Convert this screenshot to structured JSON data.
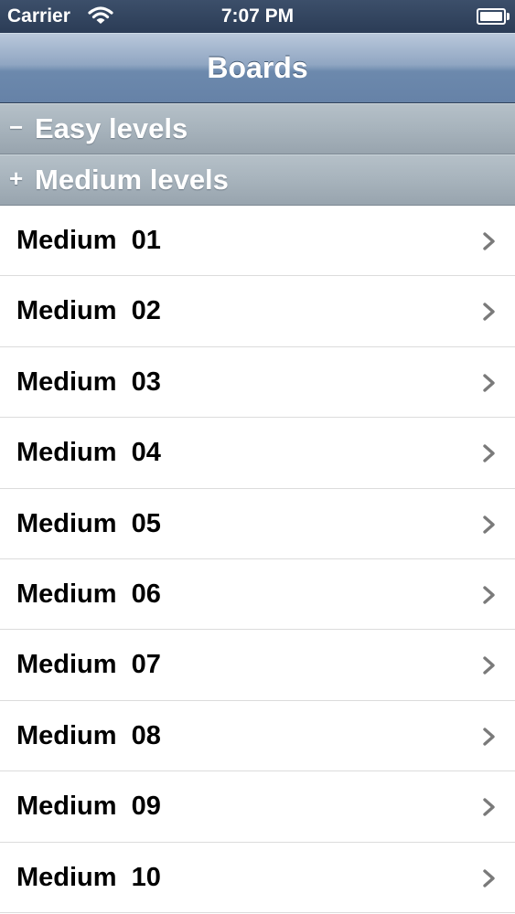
{
  "status_bar": {
    "carrier": "Carrier",
    "time": "7:07 PM"
  },
  "nav": {
    "title": "Boards"
  },
  "sections": [
    {
      "sign": "−",
      "label": "Easy levels"
    },
    {
      "sign": "+",
      "label": "Medium levels"
    }
  ],
  "rows": [
    {
      "label": "Medium  01"
    },
    {
      "label": "Medium  02"
    },
    {
      "label": "Medium  03"
    },
    {
      "label": "Medium  04"
    },
    {
      "label": "Medium  05"
    },
    {
      "label": "Medium  06"
    },
    {
      "label": "Medium  07"
    },
    {
      "label": "Medium  08"
    },
    {
      "label": "Medium  09"
    },
    {
      "label": "Medium  10"
    }
  ],
  "icons": {
    "row_accessory": "chevron-right-icon",
    "wifi": "wifi-icon",
    "battery": "battery-icon"
  }
}
